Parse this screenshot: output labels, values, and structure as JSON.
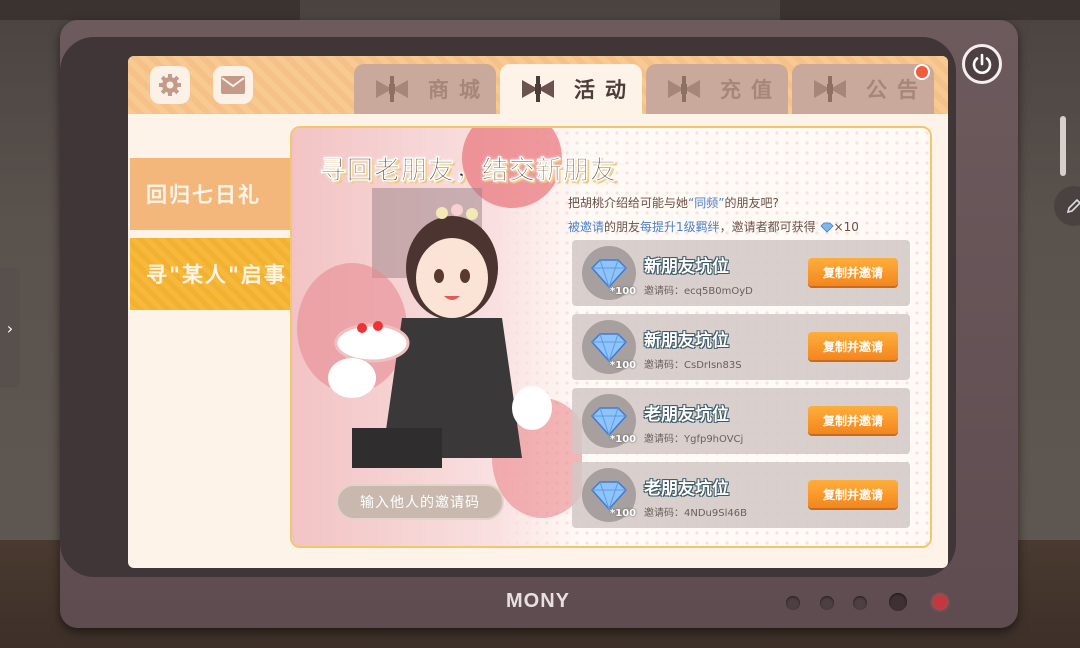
{
  "tv": {
    "brand": "MONY"
  },
  "topbar": {
    "icons": [
      "gear-icon",
      "mail-icon"
    ],
    "tabs": [
      {
        "label": "商城",
        "active": false
      },
      {
        "label": "活动",
        "active": true
      },
      {
        "label": "充值",
        "active": false
      },
      {
        "label": "公告",
        "active": false,
        "has_notification": true
      }
    ]
  },
  "menu": {
    "items": [
      {
        "label": "回归七日礼",
        "selected": false
      },
      {
        "label": "寻\"某人\"启事",
        "selected": true
      }
    ]
  },
  "panel": {
    "title": "寻回老朋友，结交新朋友",
    "desc1_pre": "把胡桃介绍给可能与她",
    "desc1_hl": "“同频”",
    "desc1_post": "的朋友吧?",
    "desc2_hl1": "被邀请",
    "desc2_mid": "的朋友",
    "desc2_hl2": "每提升1级羁绊",
    "desc2_post": "，邀请者都可获得",
    "desc2_reward": "×10",
    "input_placeholder": "输入他人的邀请码",
    "slots": [
      {
        "title": "新朋友坑位",
        "code_label": "邀请码：",
        "code": "ecq5B0mOyD",
        "reward": "*100",
        "button": "复制并邀请"
      },
      {
        "title": "新朋友坑位",
        "code_label": "邀请码：",
        "code": "CsDrIsn83S",
        "reward": "*100",
        "button": "复制并邀请"
      },
      {
        "title": "老朋友坑位",
        "code_label": "邀请码：",
        "code": "Ygfp9hOVCj",
        "reward": "*100",
        "button": "复制并邀请"
      },
      {
        "title": "老朋友坑位",
        "code_label": "邀请码：",
        "code": "4NDu9Sl46B",
        "reward": "*100",
        "button": "复制并邀请"
      }
    ]
  },
  "colors": {
    "accent_orange": "#f3861f",
    "menu_selected": "#f6b93b",
    "highlight_blue": "#4a7fcc"
  }
}
